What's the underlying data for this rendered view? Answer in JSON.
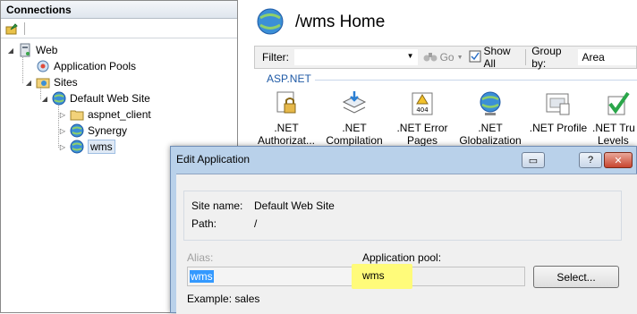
{
  "connections": {
    "title": "Connections",
    "tree": [
      {
        "label": "Web",
        "icon": "server-icon"
      },
      {
        "label": "Application Pools",
        "icon": "app-pools-icon"
      },
      {
        "label": "Sites",
        "icon": "sites-folder-icon"
      },
      {
        "label": "Default Web Site",
        "icon": "globe-icon"
      },
      {
        "label": "aspnet_client",
        "icon": "folder-icon"
      },
      {
        "label": "Synergy",
        "icon": "globe-icon"
      },
      {
        "label": "wms",
        "icon": "globe-icon",
        "selected": true
      }
    ]
  },
  "page": {
    "title": "/wms Home",
    "filter_label": "Filter:",
    "go_label": "Go",
    "show_all_label": "Show All",
    "group_by_label": "Group by:",
    "group_by_value": "Area",
    "section": "ASP.NET",
    "features": [
      {
        "line1": ".NET",
        "line2": "Authorizat...",
        "icon": "lock-document-icon"
      },
      {
        "line1": ".NET",
        "line2": "Compilation",
        "icon": "stack-arrow-icon"
      },
      {
        "line1": ".NET Error",
        "line2": "Pages",
        "icon": "error-404-icon"
      },
      {
        "line1": ".NET",
        "line2": "Globalization",
        "icon": "globe-icon"
      },
      {
        "line1": ".NET Profile",
        "line2": "",
        "icon": "profile-icon"
      },
      {
        "line1": ".NET Tru",
        "line2": "Levels",
        "icon": "trust-check-icon"
      }
    ]
  },
  "dialog": {
    "title": "Edit Application",
    "site_name_label": "Site name:",
    "site_name_value": "Default Web Site",
    "path_label": "Path:",
    "path_value": "/",
    "alias_label": "Alias:",
    "alias_value": "wms",
    "pool_label": "Application pool:",
    "pool_value": "wms",
    "select_button": "Select...",
    "example": "Example: sales"
  },
  "colors": {
    "accent": "#1f5aa6",
    "dialog_frame": "#b9d1ea",
    "highlight": "#fffb7a",
    "selection": "#3399ff"
  }
}
